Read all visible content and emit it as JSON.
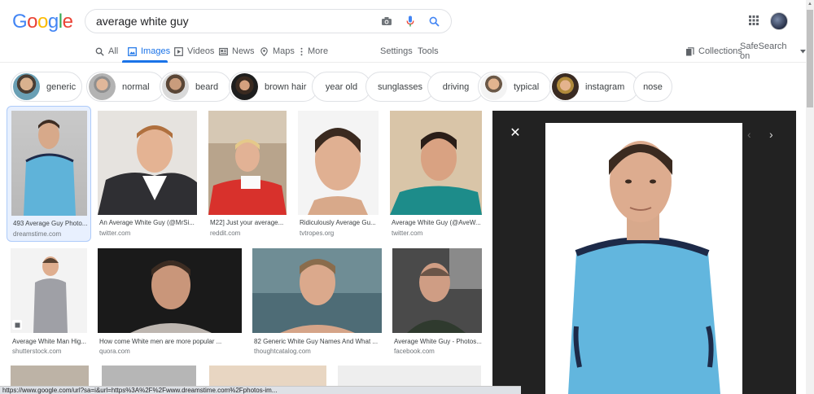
{
  "logo": [
    "G",
    "o",
    "o",
    "g",
    "l",
    "e"
  ],
  "search": {
    "query": "average white guy"
  },
  "tabs": [
    {
      "label": "All",
      "icon": "search-icon"
    },
    {
      "label": "Images",
      "icon": "image-icon"
    },
    {
      "label": "Videos",
      "icon": "play-icon"
    },
    {
      "label": "News",
      "icon": "newspaper-icon"
    },
    {
      "label": "Maps",
      "icon": "pin-icon"
    },
    {
      "label": "More",
      "icon": "kebab-icon"
    }
  ],
  "tools": {
    "settings": "Settings",
    "tools": "Tools",
    "collections": "Collections",
    "safesearch": "SafeSearch on"
  },
  "chips": [
    "generic",
    "normal",
    "beard",
    "brown hair",
    "year old",
    "sunglasses",
    "driving",
    "typical",
    "instagram",
    "nose"
  ],
  "results": [
    {
      "title": "493 Average Guy Photo...",
      "source": "dreamstime.com"
    },
    {
      "title": "An Average White Guy (@MrSi...",
      "source": "twitter.com"
    },
    {
      "title": "M22] Just your average...",
      "source": "reddit.com"
    },
    {
      "title": "Ridiculously Average Gu...",
      "source": "tvtropes.org"
    },
    {
      "title": "Average White Guy (@AveW...",
      "source": "twitter.com"
    },
    {
      "title": "Average White Man Hig...",
      "source": "shutterstock.com"
    },
    {
      "title": "How come White men are more popular ...",
      "source": "quora.com"
    },
    {
      "title": "82 Generic White Guy Names And What ...",
      "source": "thoughtcatalog.com"
    },
    {
      "title": "Average White Guy - Photos...",
      "source": "facebook.com"
    }
  ],
  "colors": {
    "blue": "#4285f4",
    "red": "#ea4335",
    "yellow": "#fbbc05",
    "green": "#34a853",
    "accent": "#1a73e8"
  },
  "status_url": "https://www.google.com/url?sa=i&url=https%3A%2F%2Fwww.dreamstime.com%2Fphotos-im..."
}
